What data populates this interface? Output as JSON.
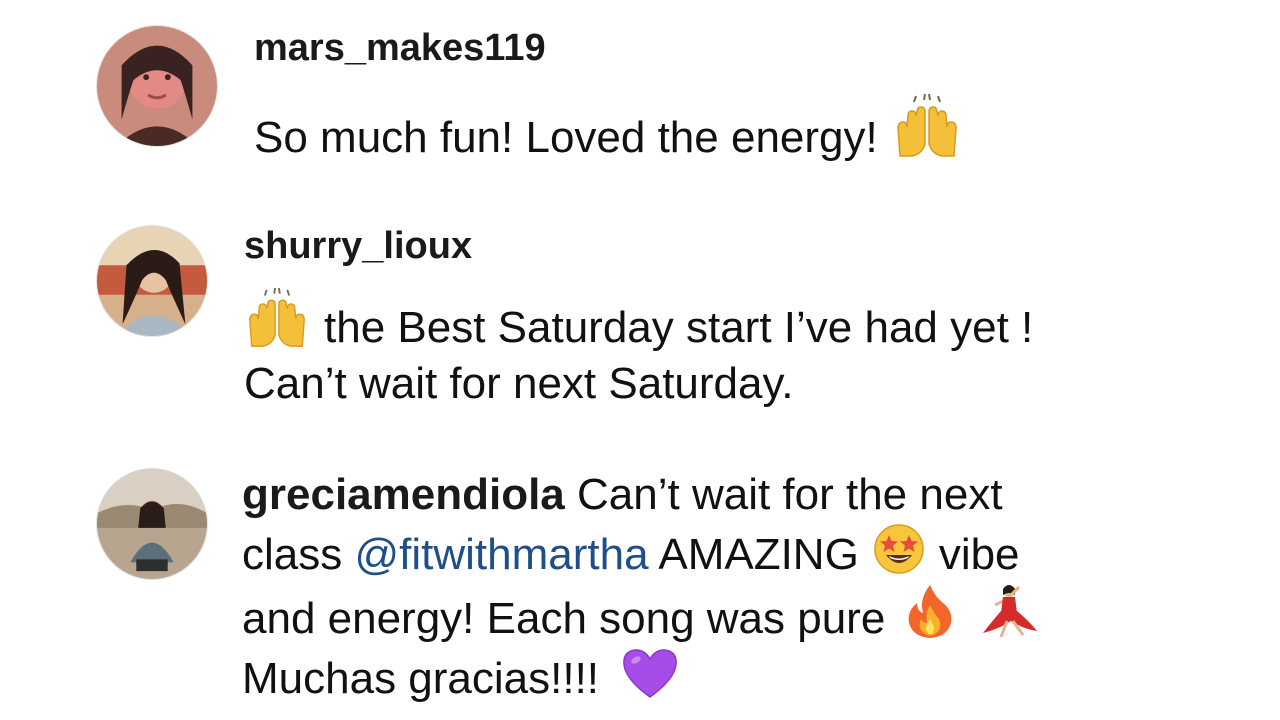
{
  "comments": [
    {
      "username": "mars_makes119",
      "text": "So much fun! Loved the energy!",
      "emoji": "raising-hands"
    },
    {
      "username": "shurry_lioux",
      "line1": "the Best Saturday start I’ve had yet !",
      "line2": "Can’t wait for next Saturday.",
      "emoji": "raising-hands"
    },
    {
      "username": "greciamendiola",
      "line1_rest": " Can’t wait for the next",
      "line2_pre": "class ",
      "mention": "@fitwithmartha",
      "line2_post": " AMAZING",
      "line2_tail": "vibe",
      "line3": "and energy! Each song was pure",
      "line4": "Muchas gracias!!!!",
      "emojis": [
        "star-struck",
        "fire",
        "woman-dancing",
        "purple-heart"
      ]
    }
  ],
  "colors": {
    "text": "#111111",
    "mention": "#1f4f8a",
    "background": "#ffffff"
  }
}
